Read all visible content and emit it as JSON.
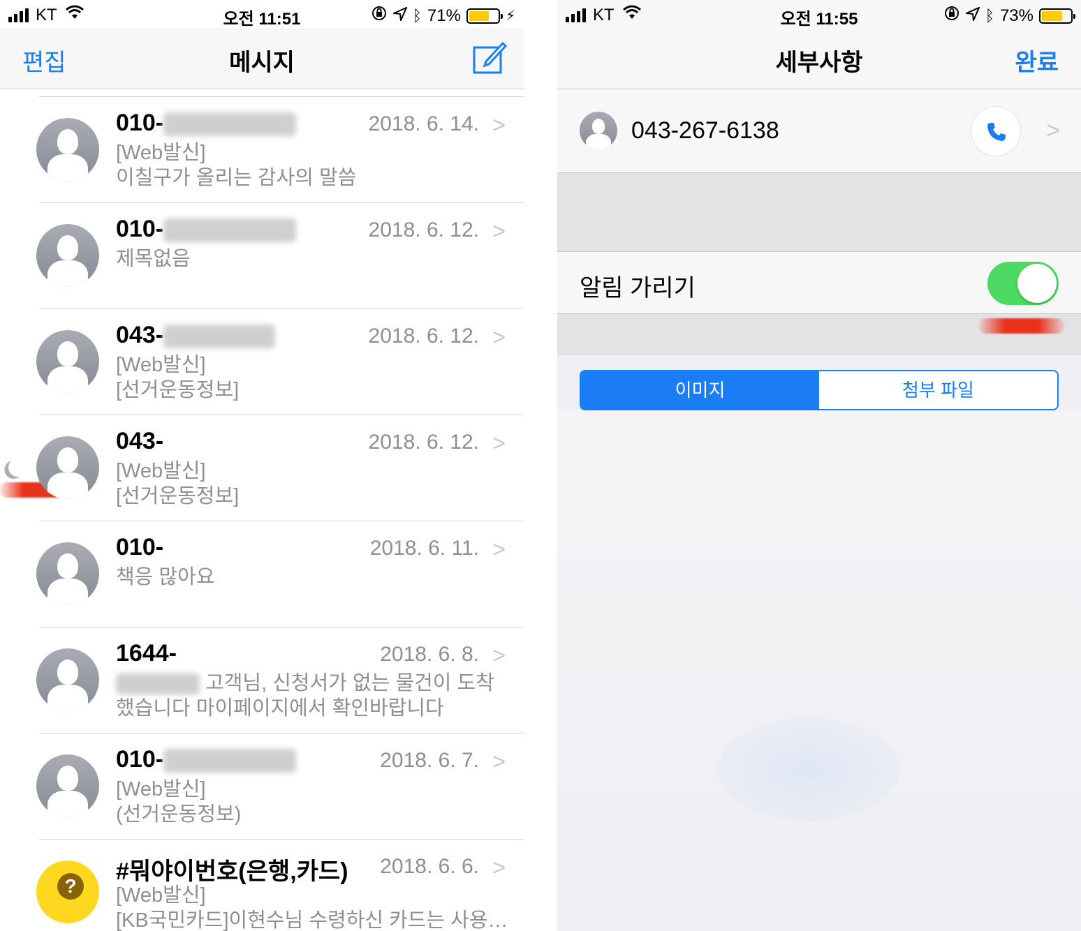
{
  "left": {
    "status": {
      "carrier": "KT",
      "time": "오전 11:51",
      "battery": "71%",
      "battery_level": 0.71
    },
    "nav": {
      "edit": "편집",
      "title": "메시지"
    },
    "messages": [
      {
        "sender": "010-",
        "date": "2018. 6. 14.",
        "line1": "[Web발신]",
        "line2": "이칠구가 올리는 감사의 말씀"
      },
      {
        "sender": "010-",
        "date": "2018. 6. 12.",
        "line1": "제목없음",
        "line2": ""
      },
      {
        "sender": "043-",
        "date": "2018. 6. 12.",
        "line1": "[Web발신]",
        "line2": "[선거운동정보]"
      },
      {
        "sender": "043-",
        "date": "2018. 6. 12.",
        "line1": "[Web발신]",
        "line2": "[선거운동정보]"
      },
      {
        "sender": "010-",
        "date": "2018. 6. 11.",
        "line1": "책응 많아요",
        "line2": ""
      },
      {
        "sender": "1644-",
        "date": "2018. 6. 8.",
        "line1": "고객님, 신청서가 없는 물건이 도착",
        "line2": "했습니다 마이페이지에서 확인바랍니다"
      },
      {
        "sender": "010-",
        "date": "2018. 6. 7.",
        "line1": "[Web발신]",
        "line2": "(선거운동정보)"
      },
      {
        "sender": "#뭐야이번호(은행,카드)",
        "date": "2018. 6. 6.",
        "line1": "[Web발신]",
        "line2": "[KB국민카드]이현수님 수령하신 카드는 사용…"
      }
    ]
  },
  "right": {
    "status": {
      "carrier": "KT",
      "time": "오전 11:55",
      "battery": "73%",
      "battery_level": 0.73
    },
    "nav": {
      "title": "세부사항",
      "done": "완료"
    },
    "contact_number": "043-267-6138",
    "mute_label": "알림 가리기",
    "mute_on": true,
    "segments": [
      "이미지",
      "첨부 파일"
    ]
  },
  "colors": {
    "accent": "#1a7df5",
    "toggle_on": "#4cd964",
    "battery": "#ffcc00"
  }
}
